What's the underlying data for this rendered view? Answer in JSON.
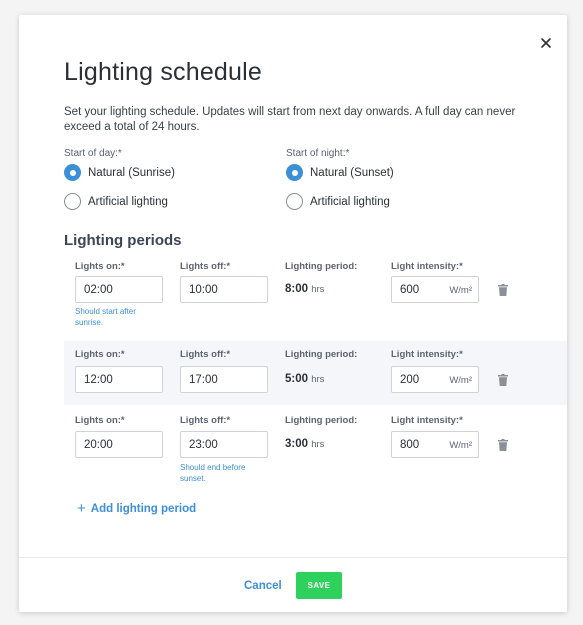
{
  "dialog": {
    "title": "Lighting schedule",
    "description": "Set your lighting schedule. Updates will start from next day onwards. A full day can never exceed a total of 24 hours."
  },
  "start_of_day": {
    "label": "Start of day:*",
    "options": [
      {
        "label": "Natural (Sunrise)",
        "selected": true
      },
      {
        "label": "Artificial lighting",
        "selected": false
      }
    ]
  },
  "start_of_night": {
    "label": "Start of night:*",
    "options": [
      {
        "label": "Natural (Sunset)",
        "selected": true
      },
      {
        "label": "Artificial lighting",
        "selected": false
      }
    ]
  },
  "periods_title": "Lighting periods",
  "labels": {
    "lights_on": "Lights on:*",
    "lights_off": "Lights off:*",
    "period": "Lighting period:",
    "intensity": "Light intensity:*",
    "hrs": "hrs",
    "intensity_unit": "W/m²"
  },
  "periods": [
    {
      "on": "02:00",
      "off": "10:00",
      "duration": "8:00",
      "intensity": "600",
      "hint_on": "Should start after sunrise.",
      "hint_off": ""
    },
    {
      "on": "12:00",
      "off": "17:00",
      "duration": "5:00",
      "intensity": "200",
      "hint_on": "",
      "hint_off": ""
    },
    {
      "on": "20:00",
      "off": "23:00",
      "duration": "3:00",
      "intensity": "800",
      "hint_on": "",
      "hint_off": "Should end before sunset."
    }
  ],
  "add_period_label": "Add lighting period",
  "footer": {
    "cancel_label": "Cancel",
    "save_label": "SAVE"
  },
  "colors": {
    "accent": "#3d8fd8",
    "save": "#2ed15c",
    "row_highlight": "#f4f6f9"
  },
  "icons": {
    "close": "close-icon",
    "delete": "trash-icon",
    "add": "plus-icon"
  }
}
